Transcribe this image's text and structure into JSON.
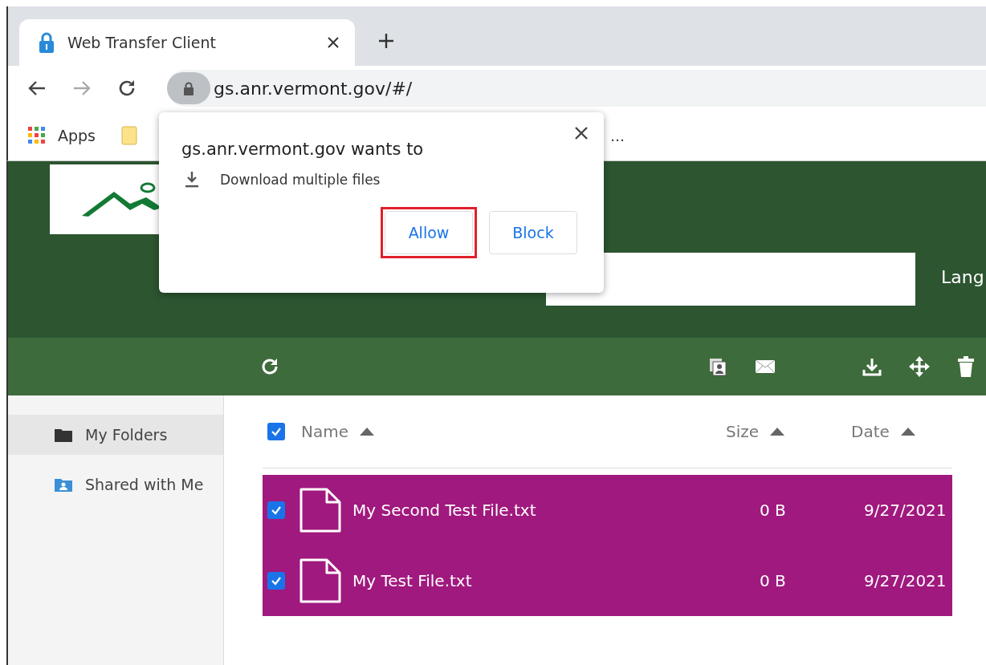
{
  "browser": {
    "tab": {
      "title": "Web Transfer Client"
    },
    "address": "gs.anr.vermont.gov/#/",
    "bookmarks": [
      {
        "kind": "apps",
        "label": "Apps"
      },
      {
        "kind": "folder"
      },
      {
        "kind": "more",
        "label": "…"
      }
    ]
  },
  "header": {
    "language_label": "Lang"
  },
  "sidebar": {
    "items": [
      {
        "label": "My Folders",
        "kind": "folder",
        "selected": true
      },
      {
        "label": "Shared with Me",
        "kind": "shared",
        "selected": false
      }
    ]
  },
  "table": {
    "select_all": {
      "checked": true
    },
    "columns": [
      {
        "label": "Name"
      },
      {
        "label": "Size"
      },
      {
        "label": "Date"
      }
    ],
    "rows": [
      {
        "name": "My Second Test File.txt",
        "size": "0 B",
        "date": "9/27/2021",
        "checked": true,
        "selected": true
      },
      {
        "name": "My Test File.txt",
        "size": "0 B",
        "date": "9/27/2021",
        "checked": true,
        "selected": true
      }
    ]
  },
  "popup": {
    "title": "gs.anr.vermont.gov wants to",
    "permission": "Download multiple files",
    "buttons": [
      {
        "label": "Allow",
        "highlighted": true
      },
      {
        "label": "Block",
        "highlighted": false
      }
    ]
  }
}
